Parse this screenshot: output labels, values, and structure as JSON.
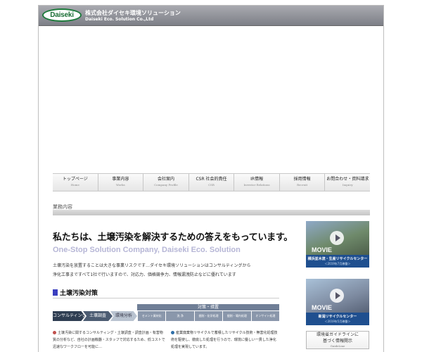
{
  "header": {
    "logo_text": "Daiseki",
    "company_name_jp": "株式会社ダイセキ環境ソリューション",
    "company_name_en": "Daiseki Eco. Solution Co.,Ltd"
  },
  "nav": {
    "items": [
      {
        "label": "トップページ",
        "sub": "Home"
      },
      {
        "label": "事業内容",
        "sub": "Works"
      },
      {
        "label": "会社案内",
        "sub": "Company Profile"
      },
      {
        "label": "CSR 社会的責任",
        "sub": "CSR"
      },
      {
        "label": "IR情報",
        "sub": "Investor Relations"
      },
      {
        "label": "採用情報",
        "sub": "Recruit"
      },
      {
        "label": "お問合わせ・資料請求",
        "sub": "Inquiry"
      }
    ]
  },
  "section": {
    "title": "業務内容"
  },
  "main": {
    "headline": "私たちは、土壌汚染を解決するための答えをもっています。",
    "subheadline": "One-Stop Solution Company, Daiseki Eco. Solution",
    "intro_line1": "土壌汚染を放置することは大きな事業リスクです…ダイセキ環境ソリューションはコンサルティングから",
    "intro_line2": "浄化工事まですべて1社で行いますので、対応力、価格競争力、情報漏洩防止などに優れています",
    "subsection_title": "土壌汚染対策"
  },
  "flow": {
    "top_label": "対策・措置",
    "steps": [
      "コンサルティング",
      "土壌調査",
      "環境分析"
    ],
    "sub_steps": [
      "セメント資材化",
      "洗 浄",
      "掘削・化学処理",
      "掘削・場内処理",
      "オンサイト処理"
    ]
  },
  "descriptions": {
    "a": "土壌汚染に関するコンサルティング・土壌調査・調査計画・有害物質の分析など、自社の計画機器・スタッフで対応するため、低コストで迅速なワークフローを可能に…",
    "a_dot_color": "#c0504d",
    "b": "産業廃棄物リサイクルで蓄積したリサイクル技術・無害化処理技術を駆使し、徹底した処理を行うので、環境に優しい一貫した浄化処理を実現しています。",
    "b_dot_color": "#2f6fa8"
  },
  "banners": [
    {
      "movie": "MOVIE",
      "title": "横浜並木流・生産リサイクルセンター",
      "sub": "＜2019年7月稼働＞"
    },
    {
      "movie": "MOVIE",
      "title": "新潟リサイクルセンター",
      "sub": "＜2019年5月稼働＞"
    }
  ],
  "guide": {
    "line1": "環境省ガイドラインに",
    "line2": "基づく情報開示",
    "line3": "GuideLine"
  }
}
